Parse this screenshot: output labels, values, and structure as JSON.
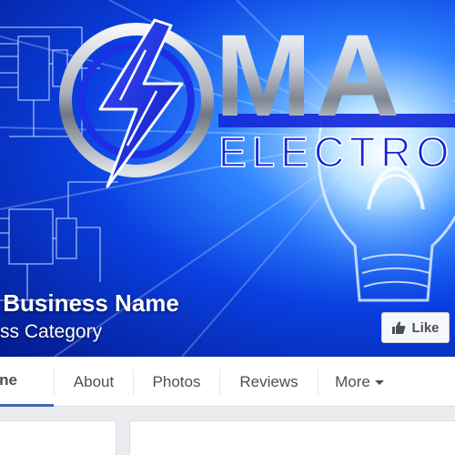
{
  "page": {
    "name": "ur Business Name",
    "category": "iness Category"
  },
  "cover": {
    "logo_line1": "MA",
    "logo_line2": "ELECTRO S",
    "colors": {
      "accent_blue": "#1226d8",
      "sky_blue": "#2f86ff",
      "deep_blue": "#031a8c"
    }
  },
  "actions": {
    "like_label": "Like",
    "like_icon": "thumbs-up-icon"
  },
  "tabs": [
    {
      "label": "eline",
      "active": true
    },
    {
      "label": "About",
      "active": false
    },
    {
      "label": "Photos",
      "active": false
    },
    {
      "label": "Reviews",
      "active": false
    },
    {
      "label": "More",
      "active": false,
      "icon": "caret-down-icon"
    }
  ],
  "colors": {
    "tab_active_underline": "#4267b2",
    "page_background": "#e9ebee",
    "tab_text": "#4b4f56"
  }
}
